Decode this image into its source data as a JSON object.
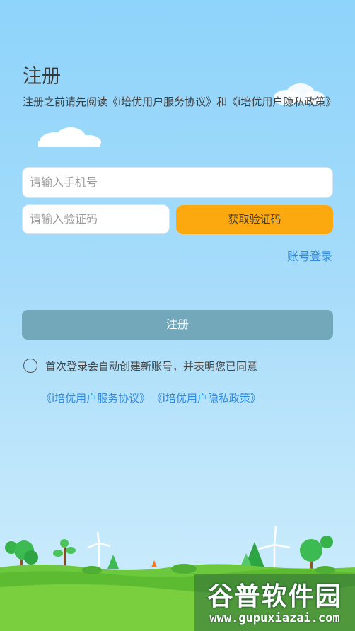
{
  "register": {
    "title": "注册",
    "intro": "注册之前请先阅读《i培优用户服务协议》和《i培优用户隐私政策》"
  },
  "form": {
    "phone_placeholder": "请输入手机号",
    "code_placeholder": "请输入验证码",
    "get_code_label": "获取验证码",
    "account_login_label": "账号登录",
    "register_button_label": "注册"
  },
  "consent": {
    "text": "首次登录会自动创建新账号，并表明您已同意",
    "service_agreement_link": "《i培优用户服务协议》",
    "privacy_policy_link": "《i培优用户隐私政策》"
  },
  "watermark": {
    "title": "谷普软件园",
    "url": "www.gupuxiazai.com"
  },
  "colors": {
    "get_code_button": "#fca90f",
    "register_button": "#73a8ba",
    "link": "#2f8be0"
  }
}
